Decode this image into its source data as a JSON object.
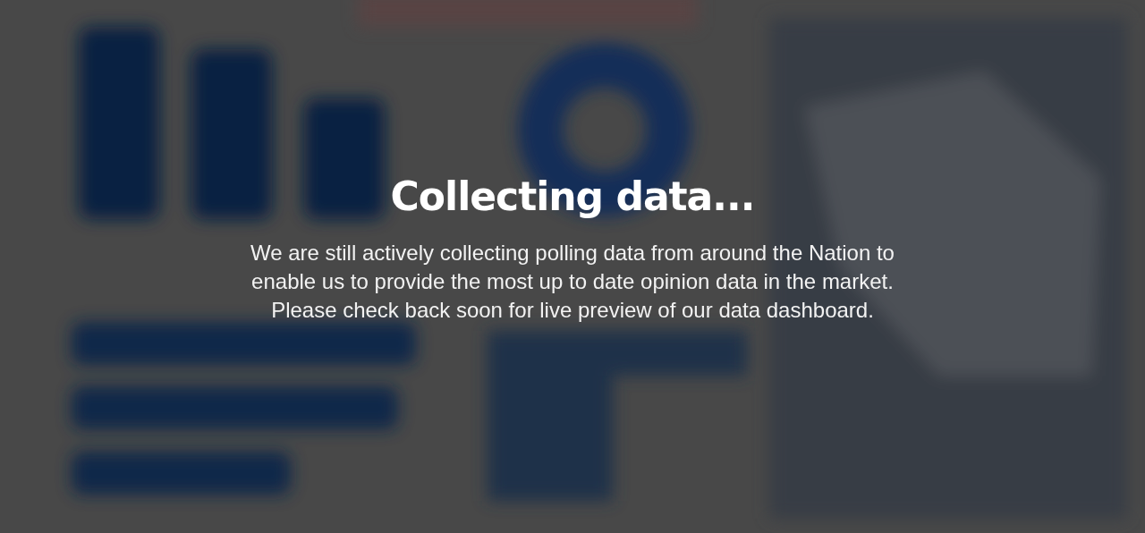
{
  "overlay": {
    "title": "Collecting data...",
    "message_lines": [
      "We are still actively collecting polling data from around the Nation to",
      "enable us to provide the most up to date opinion data in the market.",
      "Please check back soon for live preview of our data dashboard."
    ]
  }
}
